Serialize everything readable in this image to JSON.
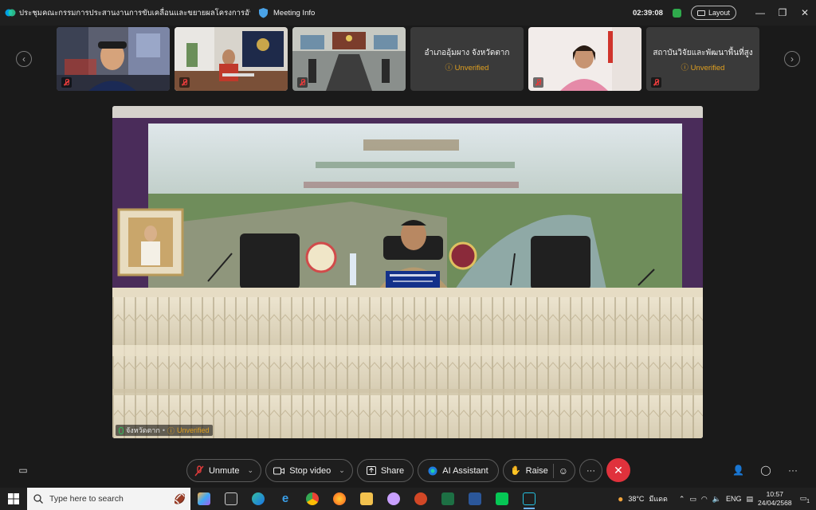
{
  "window": {
    "title": "ประชุมคณะกรรมการประสานงานการขับเคลื่อนและขยายผลโครงการอันเนื่องมา...",
    "meeting_info": "Meeting Info",
    "clock": "02:39:08",
    "layout_label": "Layout"
  },
  "participants": [
    {
      "kind": "video",
      "scene": "person"
    },
    {
      "kind": "video",
      "scene": "office"
    },
    {
      "kind": "video",
      "scene": "room"
    },
    {
      "kind": "name",
      "name": "อำเภออุ้มผาง จังหวัดตาก",
      "status": "Unverified"
    },
    {
      "kind": "video",
      "scene": "woman"
    },
    {
      "kind": "name",
      "name": "สถาบันวิจัยและพัฒนาพื้นที่สูง",
      "status": "Unverified"
    }
  ],
  "main_video": {
    "participant": "จังหวัดตาก",
    "status": "Unverified"
  },
  "controls": {
    "unmute": "Unmute",
    "stop_video": "Stop video",
    "share": "Share",
    "ai_assistant": "AI Assistant",
    "raise": "Raise"
  },
  "taskbar": {
    "search_placeholder": "Type here to search",
    "weather": "38°C",
    "weather_desc": "มีแดด",
    "lang": "ENG",
    "time": "10:57",
    "date": "24/04/2568",
    "notification_count": "1"
  },
  "colors": {
    "end_call": "#e0323c",
    "unverified": "#e0a020",
    "mic_muted": "#e23b3b",
    "mic_active": "#2fbf5a"
  }
}
